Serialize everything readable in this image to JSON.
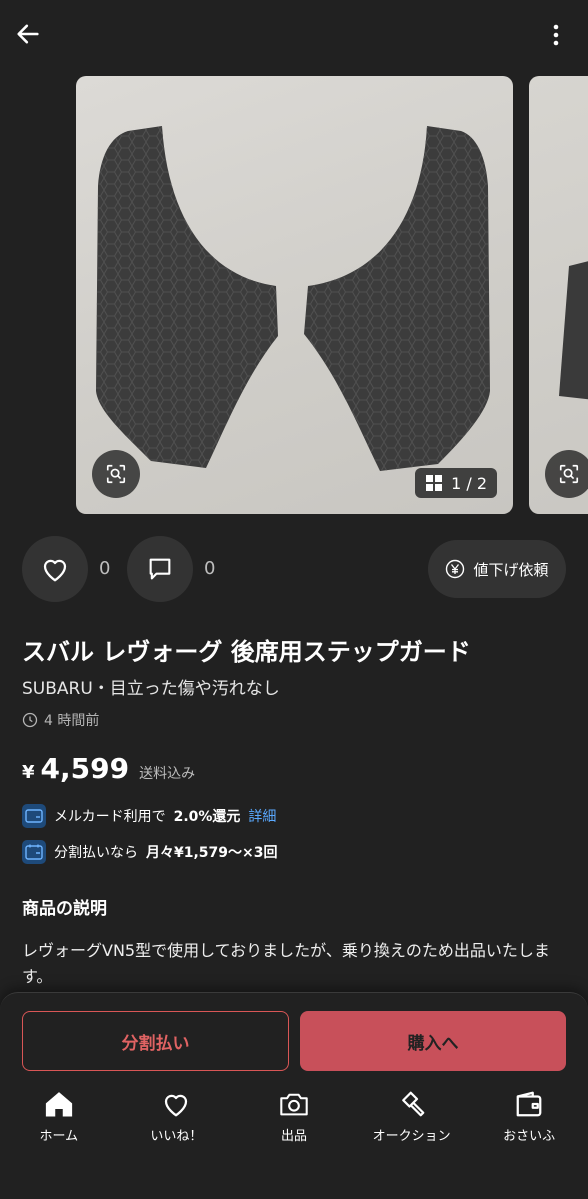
{
  "header": {
    "back_icon": "arrow-left-icon",
    "more_icon": "more-vertical-icon"
  },
  "gallery": {
    "counter": "1 / 2"
  },
  "actions": {
    "like_count": "0",
    "comment_count": "0",
    "price_request_label": "値下げ依頼"
  },
  "item": {
    "title": "スバル レヴォーグ 後席用ステップガード",
    "subtitle": "SUBARU・目立った傷や汚れなし",
    "posted": "4 時間前",
    "price_symbol": "¥",
    "price": "4,599",
    "shipping": "送料込み"
  },
  "promos": [
    {
      "pre": "メルカード利用で",
      "bold": "2.0%還元",
      "link": "詳細"
    },
    {
      "pre": "分割払いなら",
      "bold": "月々¥1,579〜×3回",
      "link": ""
    }
  ],
  "description": {
    "heading": "商品の説明",
    "text": "レヴォーグVN5型で使用しておりましたが、乗り換えのため出品いたします。"
  },
  "buttons": {
    "split": "分割払い",
    "buy": "購入へ"
  },
  "nav": [
    {
      "label": "ホーム",
      "icon": "home-icon"
    },
    {
      "label": "いいね！",
      "icon": "heart-icon"
    },
    {
      "label": "出品",
      "icon": "camera-icon"
    },
    {
      "label": "オークション",
      "icon": "gavel-icon"
    },
    {
      "label": "おさいふ",
      "icon": "wallet-icon"
    }
  ],
  "colors": {
    "background": "#212121",
    "accent": "#c8505a",
    "link": "#5aa9ff"
  }
}
